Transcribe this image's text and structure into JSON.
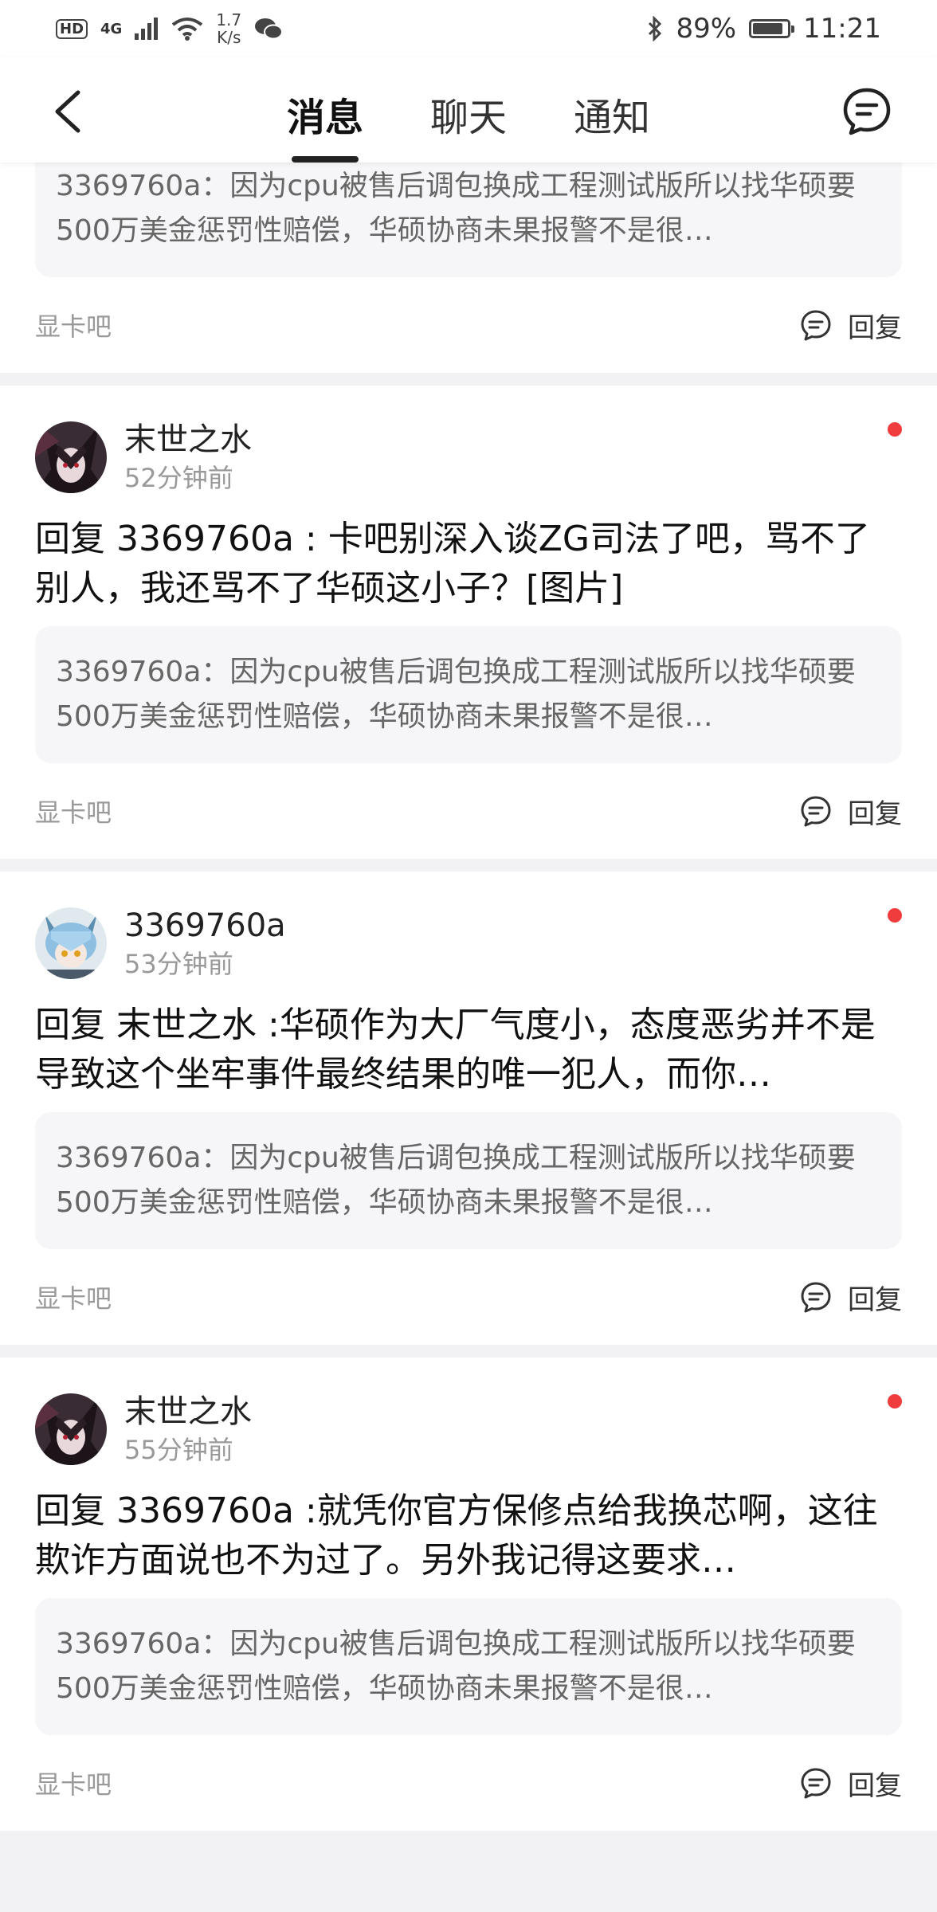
{
  "status_bar": {
    "hd": "HD",
    "network": "4G",
    "speed_value": "1.7",
    "speed_unit": "K/s",
    "battery": "89%",
    "battery_level": 0.89,
    "time": "11:21"
  },
  "header": {
    "tabs": [
      {
        "label": "消息",
        "active": true
      },
      {
        "label": "聊天",
        "active": false
      },
      {
        "label": "通知",
        "active": false
      }
    ]
  },
  "first_card": {
    "quote": "3369760a：因为cpu被售后调包换成工程测试版所以找华硕要500万美金惩罚性赔偿，华硕协商未果报警不是很…",
    "forum": "显卡吧",
    "reply_label": "回复"
  },
  "messages": [
    {
      "username": "末世之水",
      "time": "52分钟前",
      "text": "回复 3369760a : 卡吧别深入谈ZG司法了吧，骂不了别人，我还骂不了华硕这小子？[图片]",
      "quote": "3369760a：因为cpu被售后调包换成工程测试版所以找华硕要500万美金惩罚性赔偿，华硕协商未果报警不是很…",
      "forum": "显卡吧",
      "reply_label": "回复"
    },
    {
      "username": "3369760a",
      "time": "53分钟前",
      "text": "回复 末世之水 :华硕作为大厂气度小，态度恶劣并不是导致这个坐牢事件最终结果的唯一犯人，而你…",
      "quote": "3369760a：因为cpu被售后调包换成工程测试版所以找华硕要500万美金惩罚性赔偿，华硕协商未果报警不是很…",
      "forum": "显卡吧",
      "reply_label": "回复"
    },
    {
      "username": "末世之水",
      "time": "55分钟前",
      "text": "回复 3369760a :就凭你官方保修点给我换芯啊，这往欺诈方面说也不为过了。另外我记得这要求…",
      "quote": "3369760a：因为cpu被售后调包换成工程测试版所以找华硕要500万美金惩罚性赔偿，华硕协商未果报警不是很…",
      "forum": "显卡吧",
      "reply_label": "回复"
    }
  ],
  "colors": {
    "unread_dot": "#f03c3c",
    "background": "#f2f2f4",
    "quote_bg": "#f6f6f8"
  }
}
